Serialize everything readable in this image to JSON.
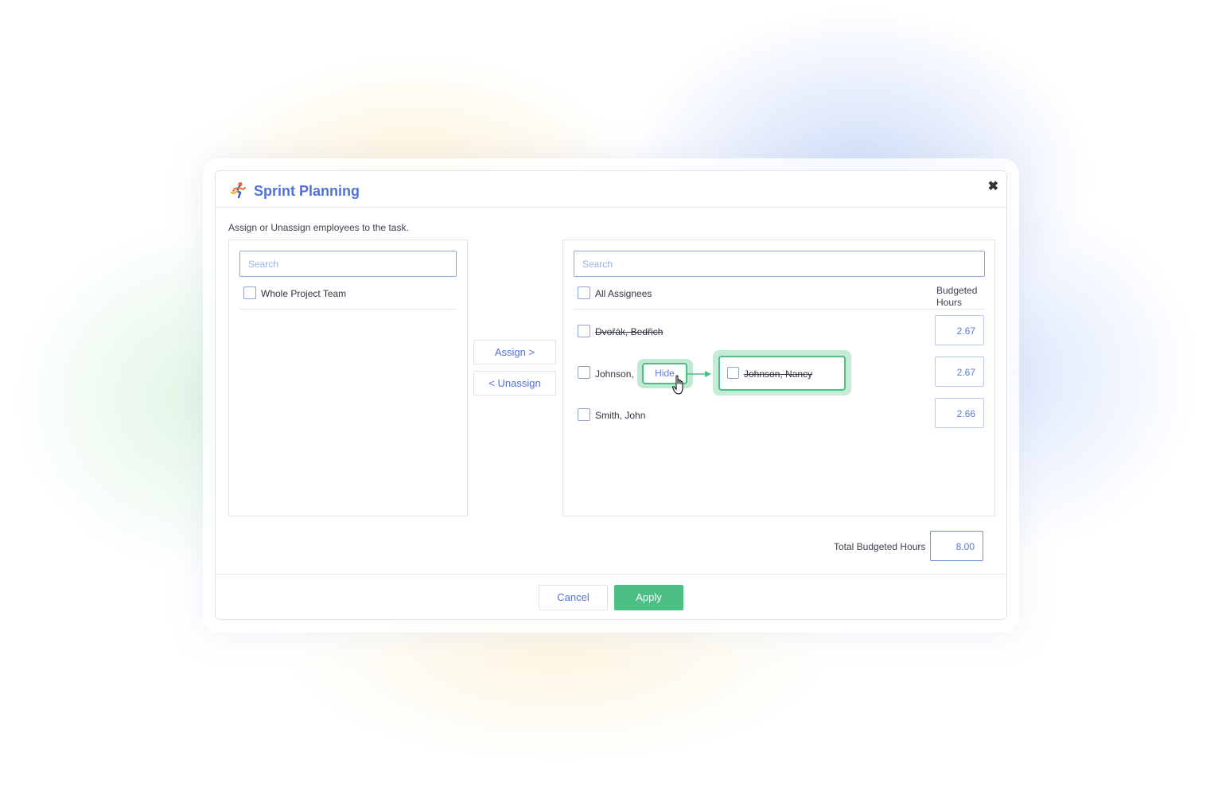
{
  "dialog": {
    "title": "Sprint Planning",
    "icon": "runner-icon",
    "close_icon": "close-icon",
    "instructions": "Assign or Unassign employees to the task."
  },
  "left_panel": {
    "search_placeholder": "Search",
    "select_all_label": "Whole Project Team",
    "items": []
  },
  "actions": {
    "assign_label": "Assign >",
    "unassign_label": "< Unassign"
  },
  "right_panel": {
    "search_placeholder": "Search",
    "select_all_label": "All Assignees",
    "column_header_line1": "Budgeted",
    "column_header_line2": "Hours",
    "rows": [
      {
        "name": "Dvořák, Bedřich",
        "hours": "2.67",
        "struck": true
      },
      {
        "name": "Johnson, N",
        "hours": "2.67",
        "struck": false
      },
      {
        "name": "Smith, John",
        "hours": "2.66",
        "struck": false
      }
    ]
  },
  "callout": {
    "hide_label": "Hide",
    "result_name": "Johnson, Nancy",
    "accent_color": "#4cbf84"
  },
  "totals": {
    "label": "Total Budgeted Hours",
    "value": "8.00"
  },
  "footer": {
    "cancel_label": "Cancel",
    "apply_label": "Apply"
  },
  "colors": {
    "brand_blue": "#4f72d8",
    "apply_green": "#4cbf84"
  }
}
